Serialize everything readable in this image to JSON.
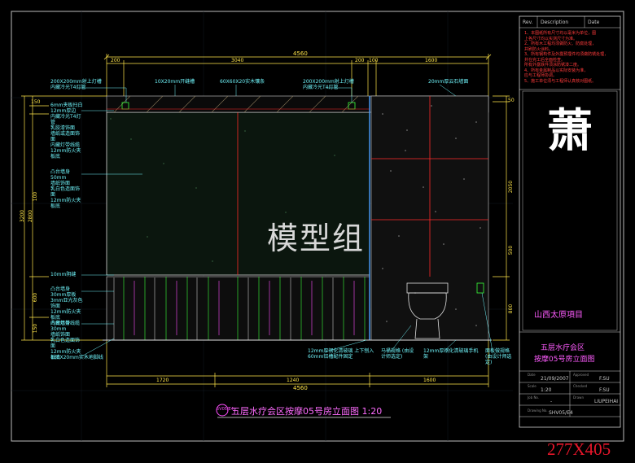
{
  "watermark": "模型组",
  "bottom_mark": "277X405",
  "top_dimensions": {
    "overall": "4560",
    "segments": [
      "200",
      "3040",
      "200",
      "100",
      "1600"
    ]
  },
  "bottom_dimensions": {
    "overall": "4560",
    "segments": [
      "1720",
      "1240",
      "1600"
    ]
  },
  "left_dimensions": {
    "overall": "3200",
    "inner": "2800",
    "segments": [
      "150",
      "100",
      "600",
      "150"
    ]
  },
  "right_dimensions": [
    "50",
    "2050",
    "500",
    "800"
  ],
  "top_annotations": [
    "200X200mm射上灯槽 内藏冷光T4灯管",
    "10X20mm开缝槽",
    "60X60X20实木镶条",
    "200X200mm射上灯槽 内藏冷光T4灯管",
    "20mm厚云石墙面"
  ],
  "left_annotations_1": [
    "6mm夹板扫白12mm厚边",
    "内藏冷光T4灯管",
    "乳胶漆饰面",
    "墙纸或造面饰面",
    "内藏灯带线缆",
    "12mm防火夹板底"
  ],
  "left_annotations_2": [
    "凸台墙身50mm",
    "墙纸饰面",
    "乳白色造面饰面",
    "12mm防火夹板底"
  ],
  "left_annotations_3": [
    "10mm阴缝"
  ],
  "left_annotations_4": [
    "凸台墙身30mm厚板",
    "3mm亚光灰色饰面",
    "12mm防火夹板底",
    "内藏灯带线缆"
  ],
  "left_annotations_5": [
    "凸台墙身30mm",
    "墙纸饰面",
    "乳白色造面饰面",
    "12mm防火夹板底"
  ],
  "left_annotations_6": [
    "160X20mm实木地脚线"
  ],
  "bottom_annotations": [
    "12mm厚钢化清玻璃 上下刨入60mm铝槽配件固定",
    "马桶规格 (由设计师选定)",
    "12mm厚钢化清玻璃手机架",
    "面板做规格 (由设计师选定)"
  ],
  "drawing_title": "五层水疗会区按摩05号房立面图 1:20",
  "drawing_tag": "5V05/E4",
  "title_block": {
    "header_left": "Rev.",
    "header_mid": "Description",
    "header_right": "Date",
    "notes": [
      "1、本图纸所有尺寸均以毫米为单位，图",
      "   上各尺寸均以实测尺寸为准。",
      "2、所有木工程均须做防火、防腐处理，",
      "   并刷防火涂料。",
      "3、所有钢构件及外露预埋件均须做防锈处理，",
      "   并在完工后全面检查。",
      "   所有外露铁件须涂防锈漆二度。",
      "4、所有金属制品以实际安装为准，",
      "   应与工程师协调。",
      "5、施工单位须与工程师认真核对图纸。"
    ],
    "logo": "萧",
    "project": "山西太原項目",
    "sheet_title_1": "五层水疗会区",
    "sheet_title_2": "按摩05号房立面图",
    "date_label": "Date",
    "date": "21/09/2007",
    "approved_label": "Approved",
    "approved": "F.SU",
    "scale_label": "Scale",
    "scale": "1:20",
    "checked_label": "Checked",
    "checked": "F.SU",
    "job_label": "Job No.",
    "job": "-",
    "drawn_label": "Drawn",
    "drawn": "LIUPEIHAI",
    "drawing_no_label": "Drawing No.",
    "drawing_no": "SHV05/E4"
  },
  "colors": {
    "background": "#000000",
    "dimension": "#ffe54a",
    "annotation": "#6ef1f7",
    "red_line": "#ff2a2a",
    "green": "#39ff39",
    "magenta": "#ff4fff",
    "frame": "#cccccc"
  }
}
